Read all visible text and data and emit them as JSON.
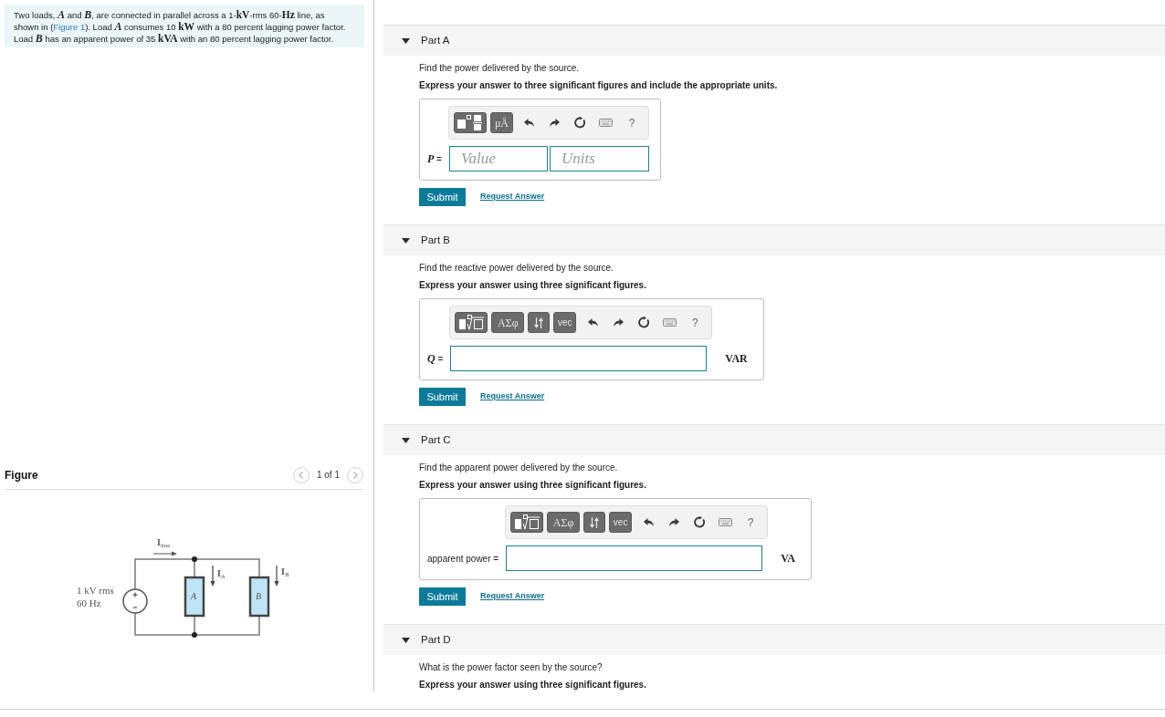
{
  "problem": {
    "before": "Two loads, *A* and *B*, are connected in parallel across a 1-**kV**-rms 60-**Hz** line, as shown in (",
    "link": "Figure 1",
    "after": "). Load *A* consumes 10 **kW** with a 80 percent lagging power factor. Load *B* has an apparent power of 35 **kVA** with an 80 percent lagging power factor."
  },
  "figure": {
    "title": "Figure",
    "pager": "1 of 1",
    "circuit": {
      "source_voltage": "1 kV rms",
      "source_frequency": "60 Hz",
      "line_current": "**I**$_{line}$",
      "current_a": "**I**$_{A}$",
      "current_b": "**I**$_{B}$",
      "load_a": "A",
      "load_b": "B"
    }
  },
  "parts": [
    {
      "title": "Part A",
      "expanded": true,
      "prompt": "Find the power delivered by the source.",
      "instruction": "Express your answer to three significant figures and include the appropriate units.",
      "toolbar": [
        {
          "kind": "fraction"
        },
        {
          "kind": "units",
          "label": "μÅ"
        },
        {
          "kind": "undo"
        },
        {
          "kind": "redo"
        },
        {
          "kind": "reset"
        },
        {
          "kind": "keyboard"
        },
        {
          "kind": "help",
          "label": "?"
        }
      ],
      "answer": {
        "label": "*P* =",
        "fields": [
          {
            "kind": "value",
            "placeholder": "Value"
          },
          {
            "kind": "units",
            "placeholder": "Units"
          }
        ]
      },
      "submit": "Submit",
      "request": "Request Answer"
    },
    {
      "title": "Part B",
      "expanded": true,
      "prompt": "Find the reactive power delivered by the source.",
      "instruction": "Express your answer using three significant figures.",
      "toolbar": [
        {
          "kind": "root"
        },
        {
          "kind": "symbols",
          "label": "ΑΣφ"
        },
        {
          "kind": "arrows"
        },
        {
          "kind": "vector",
          "label": "vec"
        },
        {
          "kind": "undo"
        },
        {
          "kind": "redo"
        },
        {
          "kind": "reset"
        },
        {
          "kind": "keyboard"
        },
        {
          "kind": "help",
          "label": "?"
        }
      ],
      "answer": {
        "label": "*Q* =",
        "fields": [
          {
            "kind": "expression"
          }
        ],
        "unit": "VAR"
      },
      "submit": "Submit",
      "request": "Request Answer"
    },
    {
      "title": "Part C",
      "expanded": true,
      "prompt": "Find the apparent power delivered by the source.",
      "instruction": "Express your answer using three significant figures.",
      "toolbar": [
        {
          "kind": "root"
        },
        {
          "kind": "symbols",
          "label": "ΑΣφ"
        },
        {
          "kind": "arrows"
        },
        {
          "kind": "vector",
          "label": "vec"
        },
        {
          "kind": "undo"
        },
        {
          "kind": "redo"
        },
        {
          "kind": "reset"
        },
        {
          "kind": "keyboard"
        },
        {
          "kind": "help",
          "label": "?"
        }
      ],
      "answer": {
        "label": "apparent power =",
        "fields": [
          {
            "kind": "expression"
          }
        ],
        "unit": "VA"
      },
      "submit": "Submit",
      "request": "Request Answer"
    },
    {
      "title": "Part D",
      "expanded": true,
      "prompt": "What is the power factor seen by the source?",
      "instruction": "Express your answer using three significant figures."
    }
  ]
}
